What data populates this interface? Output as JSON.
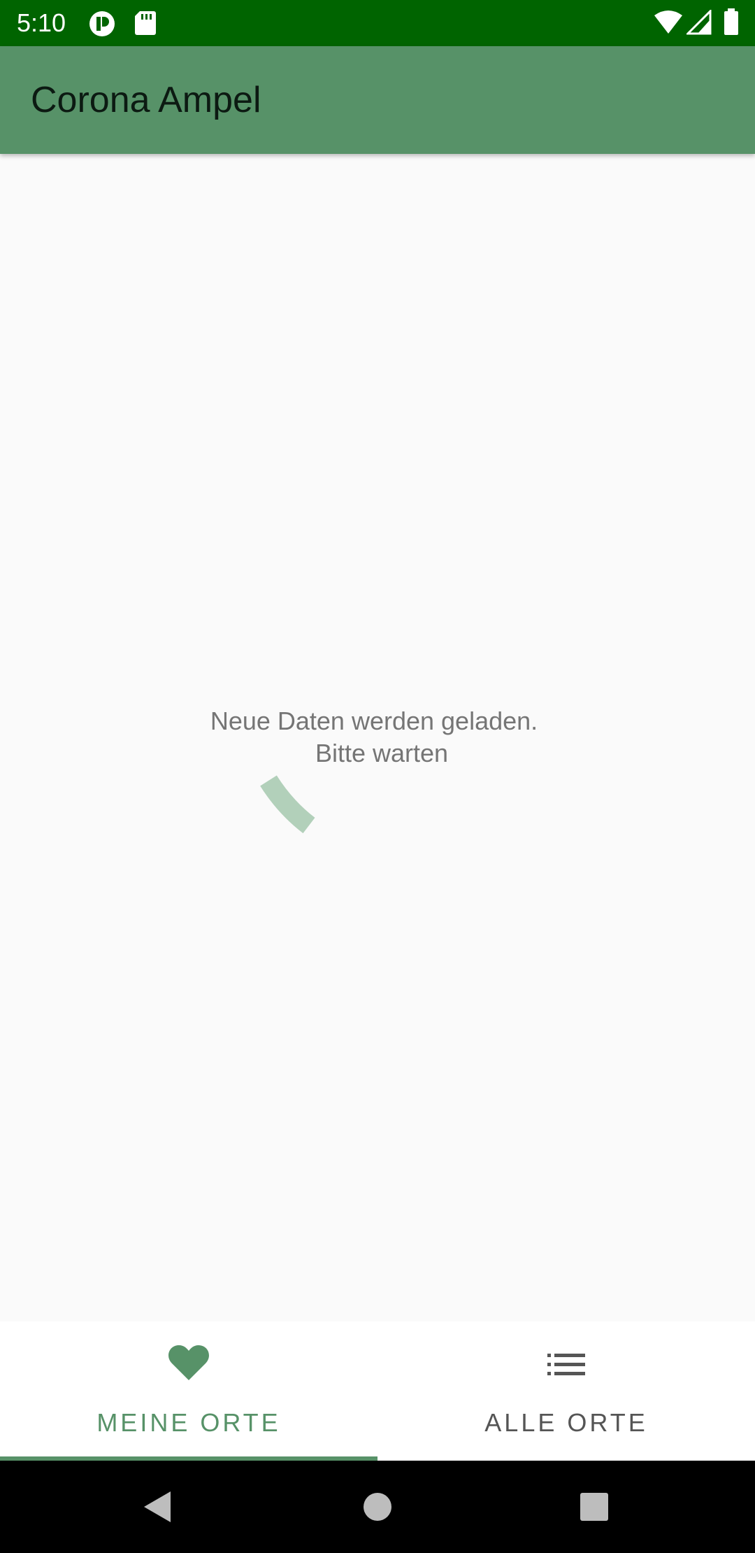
{
  "status_bar": {
    "time": "5:10",
    "icons": [
      "notification-app-icon",
      "sd-card-icon",
      "wifi-icon",
      "signal-icon",
      "battery-icon"
    ],
    "background": "#006400"
  },
  "app_bar": {
    "title": "Corona Ampel",
    "background": "#579268"
  },
  "content": {
    "loading_line1": "Neue Daten werden geladen.",
    "loading_line2": "Bitte warten",
    "spinner_color": "#B2D0BA"
  },
  "bottom_nav": {
    "tabs": [
      {
        "label": "MEINE ORTE",
        "icon": "heart-icon",
        "selected": true
      },
      {
        "label": "ALLE ORTE",
        "icon": "list-icon",
        "selected": false
      }
    ],
    "accent": "#579268"
  },
  "system_nav": {
    "buttons": [
      "back-icon",
      "home-icon",
      "recents-icon"
    ]
  }
}
